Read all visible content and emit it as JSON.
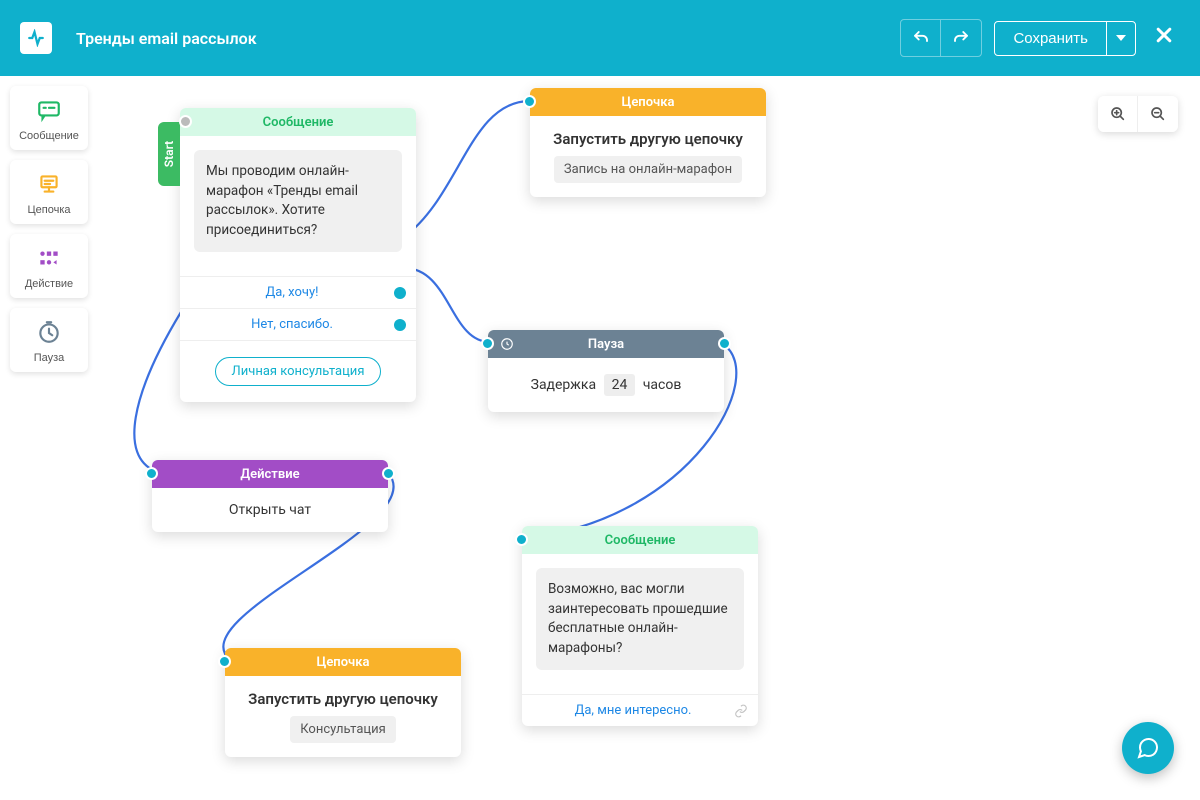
{
  "header": {
    "title": "Тренды email рассылок",
    "save": "Сохранить"
  },
  "sidebar": {
    "message": "Сообщение",
    "flow": "Цепочка",
    "action": "Действие",
    "pause": "Пауза"
  },
  "nodes": {
    "msg1": {
      "header": "Сообщение",
      "start": "Start",
      "text": "Мы проводим онлайн-марафон «Тренды email рассылок». Хотите присоединиться?",
      "opt1": "Да, хочу!",
      "opt2": "Нет, спасибо.",
      "opt3": "Личная консультация"
    },
    "flow1": {
      "header": "Цепочка",
      "title": "Запустить другую цепочку",
      "sub": "Запись на онлайн-марафон"
    },
    "pause1": {
      "header": "Пауза",
      "prefix": "Задержка",
      "value": "24",
      "suffix": "часов"
    },
    "action1": {
      "header": "Действие",
      "text": "Открыть чат"
    },
    "msg2": {
      "header": "Сообщение",
      "text": "Возможно, вас могли заинтересовать прошедшие бесплатные онлайн-марафоны?",
      "opt1": "Да, мне интересно."
    },
    "flow2": {
      "header": "Цепочка",
      "title": "Запустить другую цепочку",
      "sub": "Консультация"
    }
  }
}
